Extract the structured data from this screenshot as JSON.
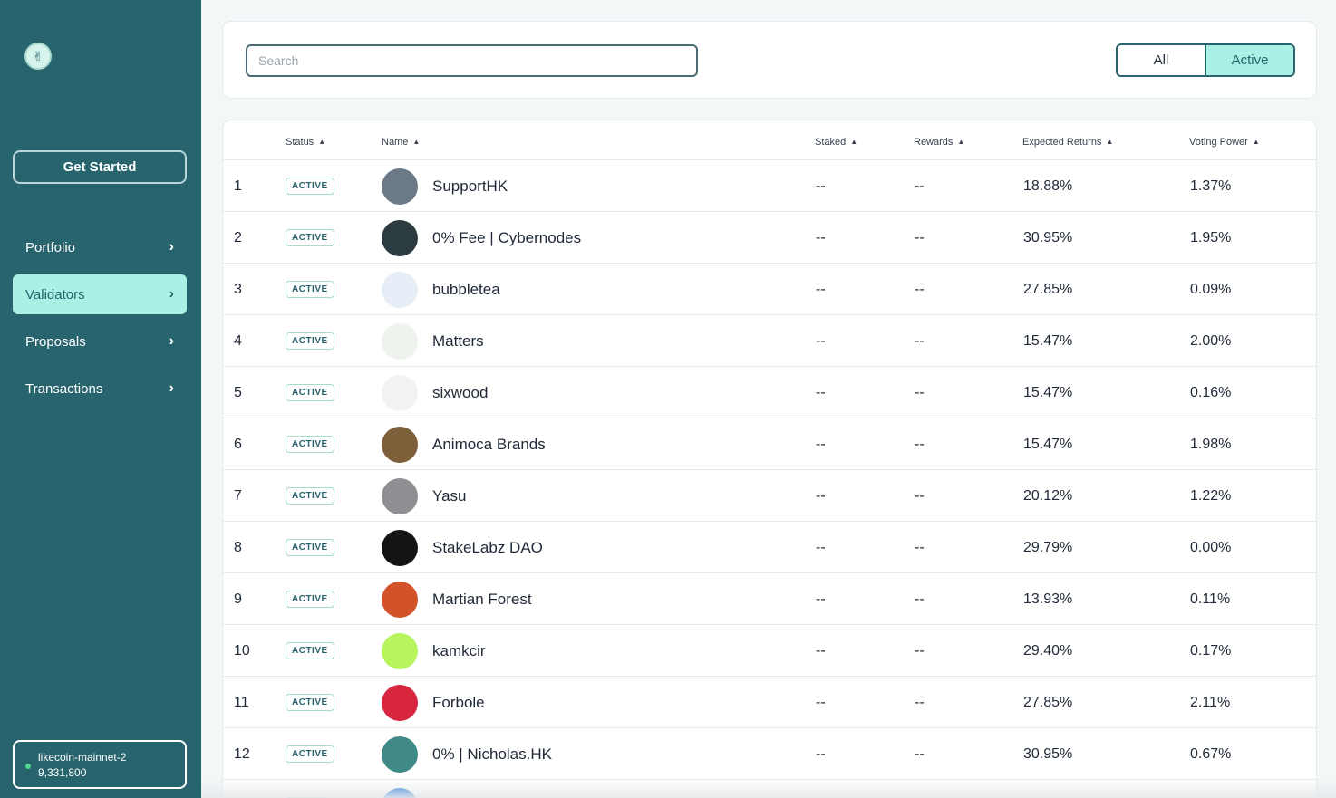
{
  "sidebar": {
    "logo_icon": "hands-logo-icon",
    "get_started_label": "Get Started",
    "items": [
      {
        "label": "Portfolio",
        "active": false
      },
      {
        "label": "Validators",
        "active": true
      },
      {
        "label": "Proposals",
        "active": false
      },
      {
        "label": "Transactions",
        "active": false
      }
    ],
    "network": {
      "name": "likecoin-mainnet-2",
      "block_height": "9,331,800",
      "status_color": "#50d890"
    }
  },
  "search": {
    "placeholder": "Search",
    "value": ""
  },
  "filter": {
    "all_label": "All",
    "active_label": "Active",
    "selected": "Active"
  },
  "table": {
    "headers": {
      "status": "Status",
      "name": "Name",
      "staked": "Staked",
      "rewards": "Rewards",
      "expected_returns": "Expected Returns",
      "voting_power": "Voting Power"
    },
    "rows": [
      {
        "index": "1",
        "status": "ACTIVE",
        "name": "SupportHK",
        "staked": "--",
        "rewards": "--",
        "expected_returns": "18.88%",
        "voting_power": "1.37%",
        "avatar_color": "#6b7a86"
      },
      {
        "index": "2",
        "status": "ACTIVE",
        "name": "0% Fee | Cybernodes",
        "staked": "--",
        "rewards": "--",
        "expected_returns": "30.95%",
        "voting_power": "1.95%",
        "avatar_color": "#2b3b3f"
      },
      {
        "index": "3",
        "status": "ACTIVE",
        "name": "bubbletea",
        "staked": "--",
        "rewards": "--",
        "expected_returns": "27.85%",
        "voting_power": "0.09%",
        "avatar_color": "#e8eef8"
      },
      {
        "index": "4",
        "status": "ACTIVE",
        "name": "Matters",
        "staked": "--",
        "rewards": "--",
        "expected_returns": "15.47%",
        "voting_power": "2.00%",
        "avatar_color": "#eef3ee"
      },
      {
        "index": "5",
        "status": "ACTIVE",
        "name": "sixwood",
        "staked": "--",
        "rewards": "--",
        "expected_returns": "15.47%",
        "voting_power": "0.16%",
        "avatar_color": "#f2f2f2"
      },
      {
        "index": "6",
        "status": "ACTIVE",
        "name": "Animoca Brands",
        "staked": "--",
        "rewards": "--",
        "expected_returns": "15.47%",
        "voting_power": "1.98%",
        "avatar_color": "#7d5f3a"
      },
      {
        "index": "7",
        "status": "ACTIVE",
        "name": "Yasu",
        "staked": "--",
        "rewards": "--",
        "expected_returns": "20.12%",
        "voting_power": "1.22%",
        "avatar_color": "#8e8e93"
      },
      {
        "index": "8",
        "status": "ACTIVE",
        "name": "StakeLabz DAO",
        "staked": "--",
        "rewards": "--",
        "expected_returns": "29.79%",
        "voting_power": "0.00%",
        "avatar_color": "#141414"
      },
      {
        "index": "9",
        "status": "ACTIVE",
        "name": "Martian Forest",
        "staked": "--",
        "rewards": "--",
        "expected_returns": "13.93%",
        "voting_power": "0.11%",
        "avatar_color": "#d2532a"
      },
      {
        "index": "10",
        "status": "ACTIVE",
        "name": "kamkcir",
        "staked": "--",
        "rewards": "--",
        "expected_returns": "29.40%",
        "voting_power": "0.17%",
        "avatar_color": "#b6f55e"
      },
      {
        "index": "11",
        "status": "ACTIVE",
        "name": "Forbole",
        "staked": "--",
        "rewards": "--",
        "expected_returns": "27.85%",
        "voting_power": "2.11%",
        "avatar_color": "#d7263d"
      },
      {
        "index": "12",
        "status": "ACTIVE",
        "name": "0% | Nicholas.HK",
        "staked": "--",
        "rewards": "--",
        "expected_returns": "30.95%",
        "voting_power": "0.67%",
        "avatar_color": "#3f8a86"
      },
      {
        "index": "",
        "status": "",
        "name": "",
        "staked": "",
        "rewards": "",
        "expected_returns": "",
        "voting_power": "",
        "avatar_color": "#2f7fd8"
      }
    ]
  }
}
